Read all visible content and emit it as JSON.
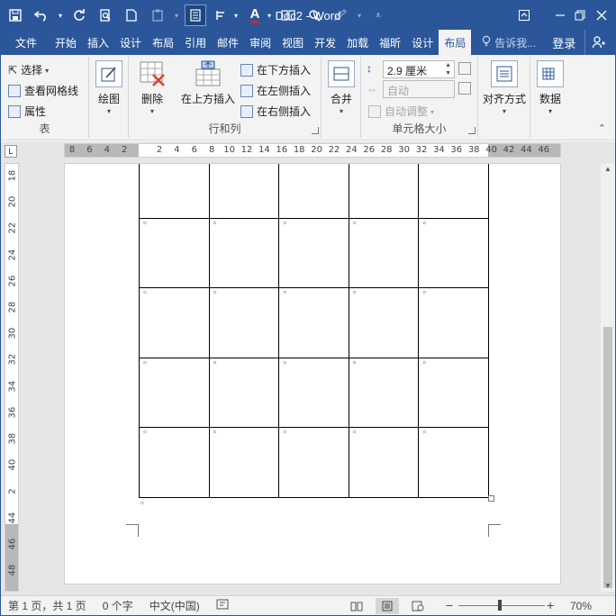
{
  "window": {
    "title": "Doc2 - Word"
  },
  "qat": {
    "save_icon": "save-icon",
    "undo_icon": "undo-icon",
    "redo_icon": "repeat-icon",
    "print_preview_icon": "print-preview-icon",
    "new_icon": "new-document-icon",
    "customize_icon": "customize-qat-icon"
  },
  "tabs": {
    "items": [
      "文件",
      "开始",
      "插入",
      "设计",
      "布局",
      "引用",
      "邮件",
      "审阅",
      "视图",
      "开发",
      "加载",
      "福昕",
      "设计",
      "布局"
    ],
    "tell_me": "告诉我...",
    "login": "登录"
  },
  "ribbon": {
    "table_group": {
      "label": "表",
      "select": "选择",
      "view_gridlines": "查看网格线",
      "properties": "属性"
    },
    "draw_group": {
      "draw_table": "绘图"
    },
    "rows_cols_group": {
      "label": "行和列",
      "delete": "删除",
      "insert_above": "在上方插入",
      "insert_below": "在下方插入",
      "insert_left": "在左侧插入",
      "insert_right": "在右侧插入"
    },
    "merge_group": {
      "merge": "合并"
    },
    "cell_size_group": {
      "label": "单元格大小",
      "height_value": "2.9 厘米",
      "width_value": "自动",
      "autofit": "自动调整"
    },
    "alignment_group": {
      "alignment": "对齐方式"
    },
    "data_group": {
      "data": "数据"
    }
  },
  "hruler_ticks": [
    "8",
    "6",
    "4",
    "2",
    "",
    "2",
    "4",
    "6",
    "8",
    "10",
    "12",
    "14",
    "16",
    "18",
    "20",
    "22",
    "24",
    "26",
    "28",
    "30",
    "32",
    "34",
    "36",
    "38",
    "40",
    "42",
    "44",
    "46"
  ],
  "vruler_ticks": [
    "18",
    "20",
    "22",
    "24",
    "26",
    "28",
    "30",
    "32",
    "34",
    "36",
    "38",
    "40",
    "2",
    "44",
    "46",
    "48"
  ],
  "statusbar": {
    "page": "第 1 页，共 1 页",
    "words": "0 个字",
    "language": "中文(中国)",
    "zoom": "70%"
  },
  "table": {
    "rows": 5,
    "cols": 5
  }
}
